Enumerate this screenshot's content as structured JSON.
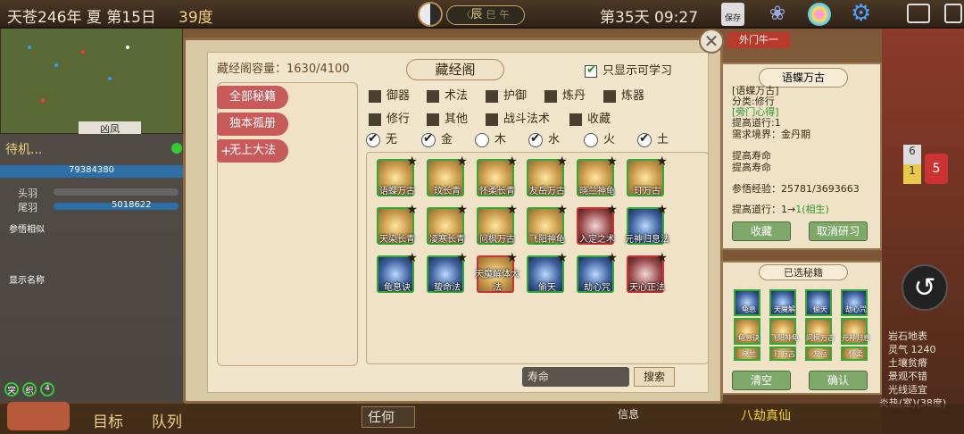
{
  "topbar": {
    "date": "天苍246年 夏 第15日",
    "temp": "39度",
    "chen": "辰",
    "si": "巳",
    "wu": "午",
    "day": "第35天 09:27",
    "save": "保存"
  },
  "left": {
    "map_label": "凶凤",
    "name": "待机...",
    "number": "79384380",
    "row1": "头羽",
    "row2": "尾羽",
    "row2_val": "5018622",
    "btn1": "参悟相似",
    "btn2": "显示名称"
  },
  "window": {
    "capacity": "藏经阁容量：1630/4100",
    "title": "藏经阁",
    "only_learnable": "只显示可学习",
    "categories": [
      "全部秘籍",
      "独本孤册",
      "无上大法"
    ],
    "filters_row1": [
      "御器",
      "术法",
      "护御",
      "炼丹",
      "炼器"
    ],
    "filters_row2": [
      "修行",
      "其他",
      "战斗法术",
      "收藏"
    ],
    "elements": [
      {
        "label": "无",
        "checked": true
      },
      {
        "label": "金",
        "checked": true
      },
      {
        "label": "木",
        "checked": false
      },
      {
        "label": "水",
        "checked": true
      },
      {
        "label": "火",
        "checked": false
      },
      {
        "label": "土",
        "checked": true
      }
    ],
    "books": [
      {
        "name": "语蝶万古",
        "type": "gold"
      },
      {
        "name": "玟长青",
        "type": "gold"
      },
      {
        "name": "怀柔长青",
        "type": "gold"
      },
      {
        "name": "友岳万古",
        "type": "gold"
      },
      {
        "name": "晓兰神龟",
        "type": "gold"
      },
      {
        "name": "玎万古",
        "type": "gold"
      },
      {
        "name": "天染长青",
        "type": "gold"
      },
      {
        "name": "凌寒长青",
        "type": "gold"
      },
      {
        "name": "问枫万古",
        "type": "gold"
      },
      {
        "name": "飞阳神龟",
        "type": "gold"
      },
      {
        "name": "入定之术",
        "type": "red"
      },
      {
        "name": "元神归息法",
        "type": "blue"
      },
      {
        "name": "龟息诀",
        "type": "blue"
      },
      {
        "name": "蛰命法",
        "type": "blue"
      },
      {
        "name": "天魔解体大法",
        "type": "redgold"
      },
      {
        "name": "偷天",
        "type": "blue"
      },
      {
        "name": "劫心咒",
        "type": "blue"
      },
      {
        "name": "天心正法",
        "type": "red"
      }
    ],
    "search_value": "寿命",
    "search_btn": "搜索"
  },
  "detail": {
    "title": "语蝶万古",
    "line0": "[语蝶万古]",
    "category": "分类:修行",
    "tag": "[旁门心得]",
    "improve": "提高道行:1",
    "need": "需求境界：金丹期",
    "eff1": "提高寿命",
    "eff2": "提高寿命",
    "exp": "参悟经验：25781/3693663",
    "dao_prefix": "提高道行：1→",
    "dao_suffix": "1(相生)",
    "fav_btn": "收藏",
    "cancel_btn": "取消研习",
    "neighbor": "外门牛一"
  },
  "selected": {
    "title": "已选秘籍",
    "items": [
      "龟息",
      "天魔解",
      "偷天",
      "劫心咒",
      "龟息诀",
      "飞阳神龟",
      "问枫万古",
      "元神归息",
      "晓兰",
      "玎万古",
      "友岳",
      "怀柔"
    ],
    "clear_btn": "清空",
    "confirm_btn": "确认"
  },
  "right": {
    "badge1": "6",
    "badge2": "1",
    "badge3": "5",
    "r1": "岩石地表",
    "r2": "灵气 1240",
    "r3": "土壤贫瘠",
    "r4": "景观不错",
    "r5": "光线适宜",
    "r6": "炎热(室)(38度)"
  },
  "bottom": {
    "goal": "目标",
    "team": "队列",
    "any": "任何",
    "info": "信息",
    "realm": "八劫真仙",
    "n": "4",
    "stats": [
      "突",
      "织",
      "4"
    ]
  }
}
